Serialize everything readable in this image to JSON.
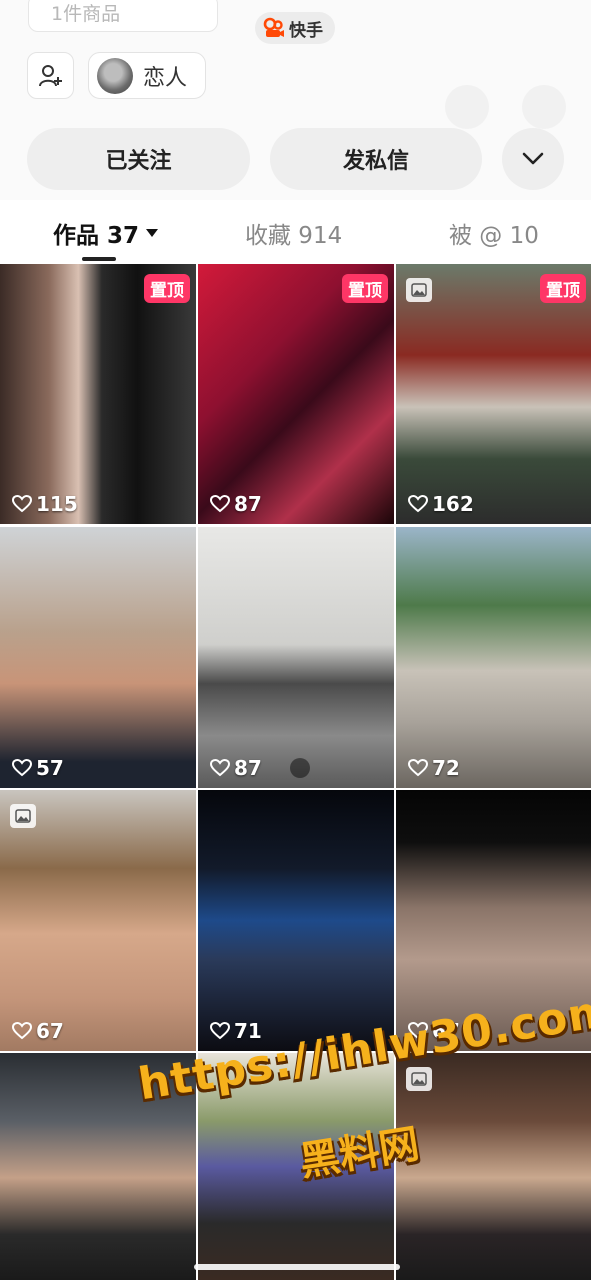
{
  "header": {
    "goods_count": "1件商品",
    "brand": "快手",
    "relation_label": "恋人"
  },
  "actions": {
    "followed": "已关注",
    "message": "发私信"
  },
  "tabs": [
    {
      "label": "作品 37"
    },
    {
      "label": "收藏 914"
    },
    {
      "label": "被 @ 10"
    }
  ],
  "pin_label": "置顶",
  "grid": [
    {
      "likes": "115",
      "pinned": true
    },
    {
      "likes": "87",
      "pinned": true
    },
    {
      "likes": "162",
      "pinned": true,
      "album": true
    },
    {
      "likes": "57"
    },
    {
      "likes": "87"
    },
    {
      "likes": "72"
    },
    {
      "likes": "67",
      "album": true
    },
    {
      "likes": "71"
    },
    {
      "likes": "67"
    },
    {
      "likes": ""
    },
    {
      "likes": ""
    },
    {
      "likes": ""
    }
  ],
  "watermark": {
    "url": "https://ihlw30.com",
    "site": "黑料网"
  },
  "colors": {
    "pin_badge": "#fe3666",
    "brand_orange": "#ff4906",
    "watermark_gold": "#f6b11c"
  }
}
